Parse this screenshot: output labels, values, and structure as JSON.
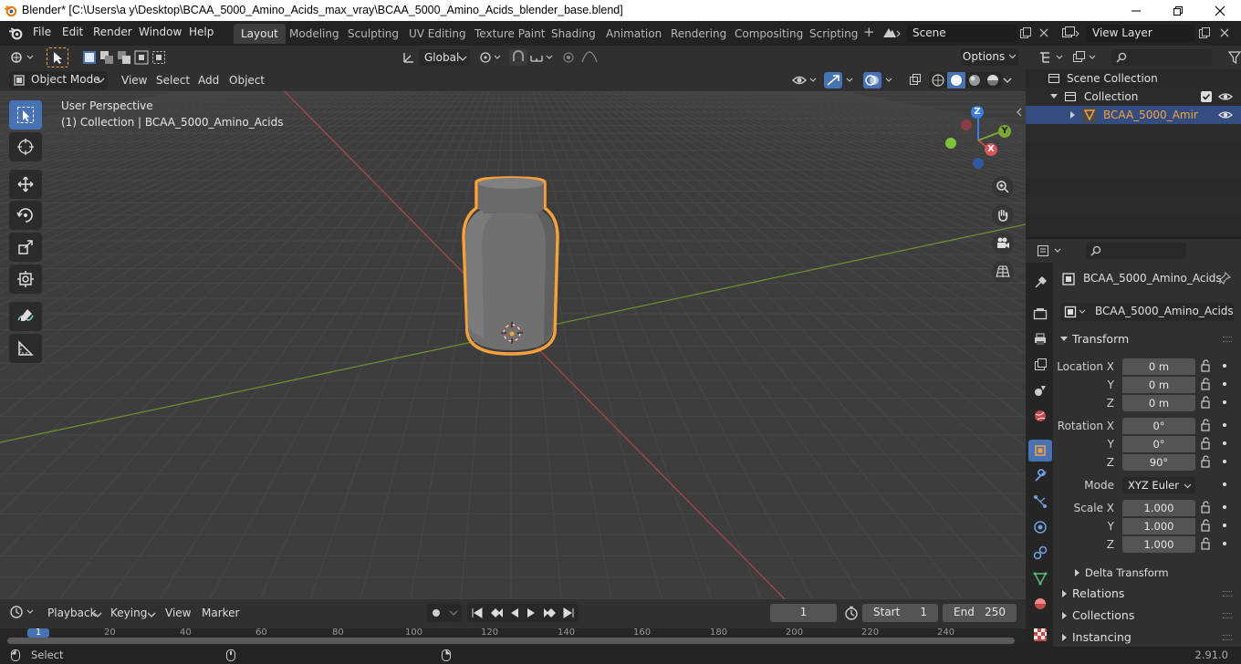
{
  "window": {
    "title": "Blender* [C:\\Users\\a y\\Desktop\\BCAA_5000_Amino_Acids_max_vray\\BCAA_5000_Amino_Acids_blender_base.blend]"
  },
  "menus": [
    "File",
    "Edit",
    "Render",
    "Window",
    "Help"
  ],
  "workspaces": [
    "Layout",
    "Modeling",
    "Sculpting",
    "UV Editing",
    "Texture Paint",
    "Shading",
    "Animation",
    "Rendering",
    "Compositing",
    "Scripting"
  ],
  "active_workspace": "Layout",
  "scene": {
    "name": "Scene",
    "view_layer": "View Layer"
  },
  "tool_header": {
    "orientation": "Global",
    "options": "Options"
  },
  "viewport_header": {
    "mode": "Object Mode",
    "menus": [
      "View",
      "Select",
      "Add",
      "Object"
    ]
  },
  "viewport": {
    "perspective": "User Perspective",
    "collection_info": "(1) Collection | BCAA_5000_Amino_Acids"
  },
  "gizmo": {
    "x": "X",
    "y": "Y",
    "z": "Z"
  },
  "outliner": {
    "scene_collection": "Scene Collection",
    "collection": "Collection",
    "object": "BCAA_5000_Amino_"
  },
  "properties": {
    "object_name": "BCAA_5000_Amino_Acids",
    "object_field": "BCAA_5000_Amino_Acids",
    "transform_label": "Transform",
    "location_x_label": "Location X",
    "rotation_x_label": "Rotation X",
    "scale_x_label": "Scale X",
    "y_label": "Y",
    "z_label": "Z",
    "mode_label": "Mode",
    "location": [
      "0 m",
      "0 m",
      "0 m"
    ],
    "rotation": [
      "0°",
      "0°",
      "90°"
    ],
    "mode": "XYZ Euler",
    "scale": [
      "1.000",
      "1.000",
      "1.000"
    ],
    "sections": [
      "Delta Transform",
      "Relations",
      "Collections",
      "Instancing"
    ]
  },
  "timeline": {
    "menus": [
      "Playback",
      "Keying",
      "View",
      "Marker"
    ],
    "current_frame": "1",
    "start_label": "Start",
    "start": "1",
    "end_label": "End",
    "end": "250",
    "ruler": [
      "1",
      "20",
      "40",
      "60",
      "80",
      "100",
      "120",
      "140",
      "160",
      "180",
      "200",
      "220",
      "240"
    ]
  },
  "status": {
    "left": "Select",
    "version": "2.91.0"
  },
  "colors": {
    "accent": "#4772b3",
    "selection": "#f5a23d",
    "x_axis": "#c44a4a",
    "y_axis": "#7aa833",
    "z_axis": "#3a7de0"
  }
}
